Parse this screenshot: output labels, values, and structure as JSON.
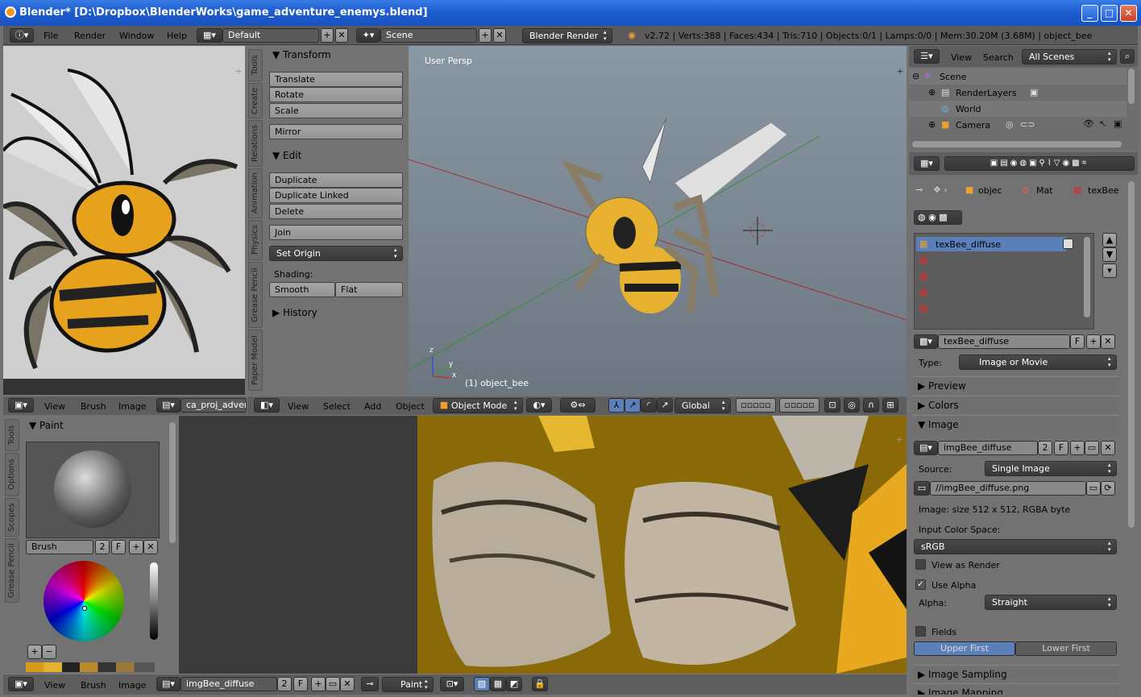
{
  "window": {
    "title": "Blender* [D:\\Dropbox\\BlenderWorks\\game_adventure_enemys.blend]",
    "min": "_",
    "max": "□",
    "close": "✕"
  },
  "infobar": {
    "menus": [
      "File",
      "Render",
      "Window",
      "Help"
    ],
    "layout": "Default",
    "scene": "Scene",
    "engine": "Blender Render",
    "stats": "v2.72 | Verts:388 | Faces:434 | Tris:710 | Objects:0/1 | Lamps:0/0 | Mem:30.20M (3.68M) | object_bee"
  },
  "toolshelf": {
    "tabs": [
      "Tools",
      "Create",
      "Relations",
      "Animation",
      "Physics",
      "Grease Pencil",
      "Paper Model"
    ],
    "transform": {
      "title": "Transform",
      "buttons": [
        "Translate",
        "Rotate",
        "Scale",
        "Mirror"
      ]
    },
    "edit": {
      "title": "Edit",
      "buttons": [
        "Duplicate",
        "Duplicate Linked",
        "Delete",
        "Join",
        "Set Origin"
      ],
      "shading_label": "Shading:",
      "smooth": "Smooth",
      "flat": "Flat"
    },
    "history": {
      "title": "History"
    }
  },
  "viewport": {
    "label": "User Persp",
    "object": "(1) object_bee",
    "axis_z": "z",
    "axis_y": "y",
    "axis_x": "x",
    "header": {
      "view": "View",
      "select": "Select",
      "add": "Add",
      "object": "Object",
      "mode": "Object Mode",
      "orientation": "Global"
    }
  },
  "image_editor_top": {
    "header": {
      "view": "View",
      "brush": "Brush",
      "image": "Image",
      "image_name": "ca_proj_advent"
    }
  },
  "paint_panel": {
    "tabs": [
      "Tools",
      "Options",
      "Scopes",
      "Grease Pencil"
    ],
    "title": "Paint",
    "brush_name": "Brush",
    "brush_users": "2",
    "fake": "F"
  },
  "image_editor_bottom": {
    "header": {
      "view": "View",
      "brush": "Brush",
      "image": "Image",
      "image_name": "imgBee_diffuse",
      "users": "2",
      "fake": "F",
      "mode": "Paint"
    }
  },
  "outliner": {
    "header": {
      "view": "View",
      "search": "Search",
      "filter": "All Scenes"
    },
    "items": [
      {
        "label": "Scene"
      },
      {
        "label": "RenderLayers"
      },
      {
        "label": "World"
      },
      {
        "label": "Camera"
      }
    ]
  },
  "properties": {
    "breadcrumb": [
      "objec",
      "Mat",
      "texBee"
    ],
    "texture_slots": [
      "texBee_diffuse"
    ],
    "texture_name": "texBee_diffuse",
    "fake": "F",
    "type_label": "Type:",
    "type_value": "Image or Movie",
    "panels": {
      "preview": "Preview",
      "colors": "Colors",
      "image": "Image",
      "image_sampling": "Image Sampling",
      "image_mapping": "Image Mapping"
    },
    "image": {
      "name": "imgBee_diffuse",
      "users": "2",
      "fake": "F",
      "source_label": "Source:",
      "source_value": "Single Image",
      "filepath": "//imgBee_diffuse.png",
      "info": "Image: size 512 x 512, RGBA byte",
      "input_cs_label": "Input Color Space:",
      "input_cs_value": "sRGB",
      "view_as_render": "View as Render",
      "use_alpha": "Use Alpha",
      "alpha_label": "Alpha:",
      "alpha_value": "Straight",
      "fields": "Fields",
      "upper_first": "Upper First",
      "lower_first": "Lower First"
    }
  }
}
